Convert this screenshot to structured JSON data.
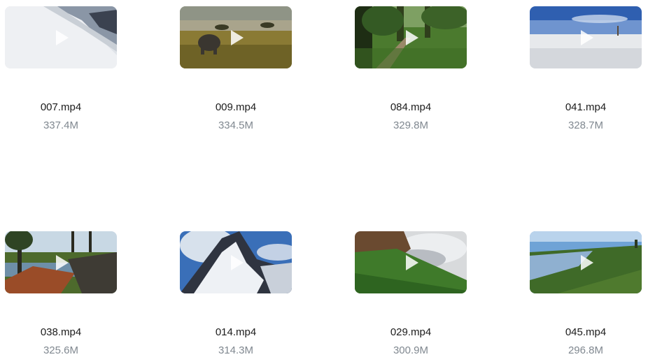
{
  "videos": [
    {
      "name": "007.mp4",
      "size": "337.4M",
      "scene": "snow-mountain"
    },
    {
      "name": "009.mp4",
      "size": "334.5M",
      "scene": "savanna-elephant"
    },
    {
      "name": "084.mp4",
      "size": "329.8M",
      "scene": "forest-path"
    },
    {
      "name": "041.mp4",
      "size": "328.7M",
      "scene": "snow-field"
    },
    {
      "name": "038.mp4",
      "size": "325.6M",
      "scene": "lake-dock"
    },
    {
      "name": "014.mp4",
      "size": "314.3M",
      "scene": "alpine-peak"
    },
    {
      "name": "029.mp4",
      "size": "300.9M",
      "scene": "green-hillside"
    },
    {
      "name": "045.mp4",
      "size": "296.8M",
      "scene": "lake-meadow"
    }
  ]
}
